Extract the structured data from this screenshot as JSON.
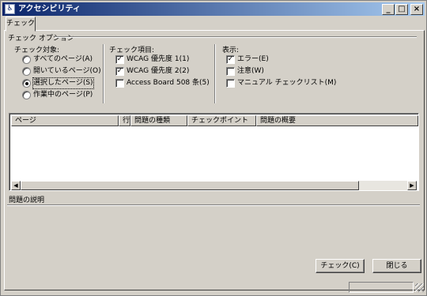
{
  "window": {
    "title": "アクセシビリティ",
    "icon": "accessibility-app-icon"
  },
  "titlebar_buttons": {
    "minimize": "_",
    "maximize": "□",
    "close": "×"
  },
  "tabs": [
    {
      "label": "チェック"
    }
  ],
  "options_group": {
    "title": "チェック オプション"
  },
  "target": {
    "label": "チェック対象:",
    "options": [
      {
        "label": "すべてのページ(A)",
        "selected": false
      },
      {
        "label": "開いているページ(O)",
        "selected": false
      },
      {
        "label": "選択したページ(S)",
        "selected": true
      },
      {
        "label": "作業中のページ(P)",
        "selected": false
      }
    ]
  },
  "items": {
    "label": "チェック項目:",
    "options": [
      {
        "label": "WCAG 優先度 1(1)",
        "checked": true
      },
      {
        "label": "WCAG 優先度 2(2)",
        "checked": true
      },
      {
        "label": "Access Board 508 条(5)",
        "checked": false
      }
    ]
  },
  "display": {
    "label": "表示:",
    "options": [
      {
        "label": "エラー(E)",
        "checked": true
      },
      {
        "label": "注意(W)",
        "checked": false
      },
      {
        "label": "マニュアル チェックリスト(M)",
        "checked": false
      }
    ]
  },
  "results_table": {
    "columns": [
      "ページ",
      "行",
      "問題の種類",
      "チェックポイント",
      "問題の概要"
    ],
    "rows": []
  },
  "description": {
    "label": "問題の説明"
  },
  "buttons": {
    "check": "チェック(C)",
    "close": "閉じる"
  },
  "check_mark": "✓"
}
